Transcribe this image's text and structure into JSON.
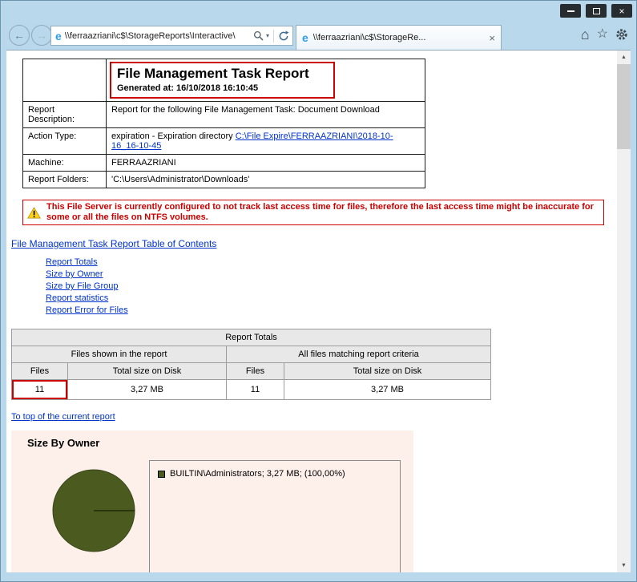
{
  "browser": {
    "address": "\\\\ferraazriani\\c$\\StorageReports\\Interactive\\",
    "tab_title": "\\\\ferraazriani\\c$\\StorageRe..."
  },
  "icons": {
    "back_arrow": "←",
    "forward_arrow": "→",
    "home": "⌂",
    "favorites_star": "☆",
    "chevron_down": "▾",
    "tab_close": "×",
    "window_close": "×",
    "ie_logo": "e",
    "scroll_up": "▲",
    "scroll_down": "▼"
  },
  "report": {
    "title": "File Management Task Report",
    "generated": "Generated at: 16/10/2018 16:10:45",
    "rows": [
      {
        "label": "Report Description:",
        "value": "Report for the following File Management Task: Document Download"
      },
      {
        "label": "Action Type:",
        "prefix": "expiration - Expiration directory ",
        "link": "C:\\File Expire\\FERRAAZRIANI\\2018-10-16_16-10-45"
      },
      {
        "label": "Machine:",
        "value": "FERRAAZRIANI"
      },
      {
        "label": "Report Folders:",
        "value": "'C:\\Users\\Administrator\\Downloads'"
      }
    ]
  },
  "warning": {
    "text": "This File Server is currently configured to not track last access time for files, therefore the last access time might be inaccurate for some or all the files on NTFS volumes."
  },
  "toc": {
    "title": "File Management Task Report Table of Contents",
    "links": [
      "Report Totals",
      "Size by Owner",
      "Size by File Group",
      "Report statistics",
      "Report Error for Files"
    ]
  },
  "totals": {
    "title": "Report Totals",
    "group_headers": [
      "Files shown in the report",
      "All files matching report criteria"
    ],
    "col_headers": [
      "Files",
      "Total size on Disk",
      "Files",
      "Total size on Disk"
    ],
    "values": [
      "11",
      "3,27 MB",
      "11",
      "3,27 MB"
    ]
  },
  "links": {
    "to_top": "To top of the current report"
  },
  "size_by_owner": {
    "title": "Size By Owner",
    "legend_text": "BUILTIN\\Administrators; 3,27 MB; (100,00%)",
    "chart_data": {
      "type": "pie",
      "labels": [
        "BUILTIN\\Administrators"
      ],
      "values_percent": [
        100.0
      ],
      "values_size": [
        "3,27 MB"
      ],
      "legend_position": "right"
    }
  },
  "colors": {
    "chrome_blue": "#b9d8ec",
    "link_blue": "#0033cc",
    "warning_red": "#cc0000",
    "annotation_red": "#cc0000",
    "pie_green": "#4b5a1f",
    "owner_section_background": "#fdf0ea",
    "header_cell_gray": "#e8e8e8"
  }
}
